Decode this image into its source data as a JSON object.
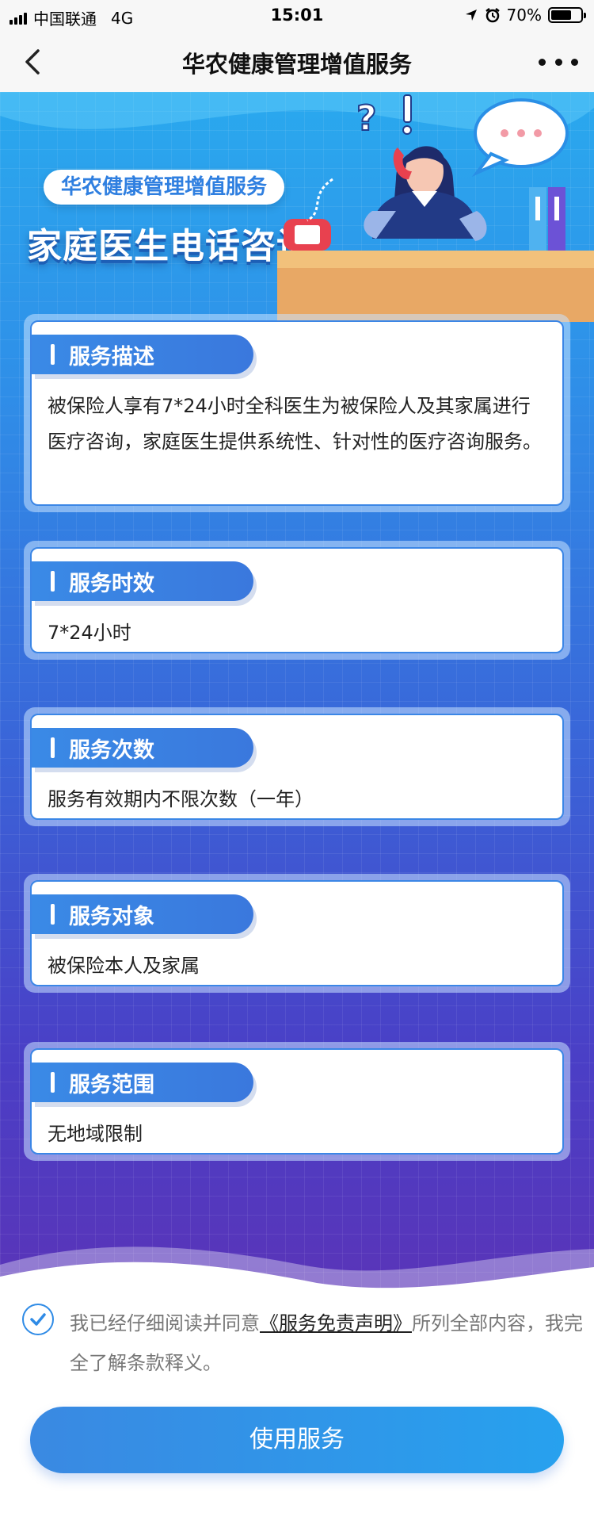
{
  "status_bar": {
    "carrier": "中国联通",
    "network": "4G",
    "time": "15:01",
    "battery": "70%",
    "battery_level": 0.7
  },
  "nav": {
    "title": "华农健康管理增值服务",
    "back_icon": "chevron-left-icon",
    "more_icon": "more-dots-icon"
  },
  "hero": {
    "subtitle": "华农健康管理增值服务",
    "title": "家庭医生电话咨询"
  },
  "cards": [
    {
      "heading": "服务描述",
      "body": "被保险人享有7*24小时全科医生为被保险人及其家属进行医疗咨询，家庭医生提供系统性、针对性的医疗咨询服务。"
    },
    {
      "heading": "服务时效",
      "body": "7*24小时"
    },
    {
      "heading": "服务次数",
      "body": "服务有效期内不限次数（一年）"
    },
    {
      "heading": "服务对象",
      "body": "被保险本人及家属"
    },
    {
      "heading": "服务范围",
      "body": "无地域限制"
    }
  ],
  "agreement": {
    "checked": true,
    "prefix": "我已经仔细阅读并同意",
    "link": "《服务免责声明》",
    "suffix": "所列全部内容，我完全了解条款释义。"
  },
  "action": {
    "use_button": "使用服务"
  },
  "colors": {
    "accent": "#3a89e2",
    "hero_top": "#2aa9ee",
    "hero_bottom": "#5a34b8"
  }
}
